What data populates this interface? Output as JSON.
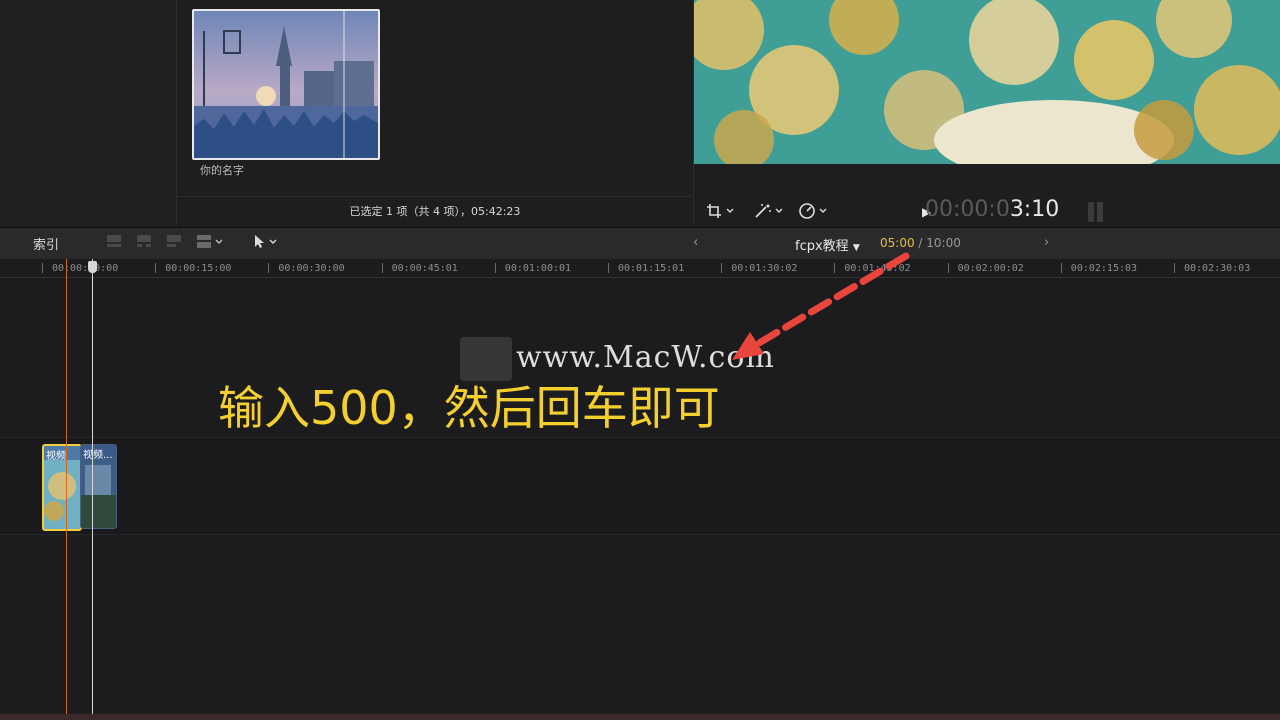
{
  "browser": {
    "clip_name": "你的名字",
    "status": "已选定 1 项（共 4 项），05:42:23"
  },
  "viewer": {
    "timecode_dim": "00:00:0",
    "timecode_bright": "3:10"
  },
  "toolbar": {
    "index_label": "索引",
    "project_name": "fcpx教程",
    "duration_current": "05:00",
    "duration_total": " / 10:00"
  },
  "ruler": {
    "ticks": [
      "00:00:00:00",
      "00:00:15:00",
      "00:00:30:00",
      "00:00:45:01",
      "00:01:00:01",
      "00:01:15:01",
      "00:01:30:02",
      "00:01:45:02",
      "00:02:00:02",
      "00:02:15:03",
      "00:02:30:03"
    ]
  },
  "clips": [
    {
      "label": "视频"
    },
    {
      "label": "视频..."
    }
  ],
  "overlay": {
    "watermark": "www.MacW.com",
    "instruction": "输入500，然后回车即可"
  },
  "colors": {
    "accent_yellow": "#f3cf30",
    "arrow_red": "#e8453c",
    "playhead_orange": "#d2691e"
  }
}
